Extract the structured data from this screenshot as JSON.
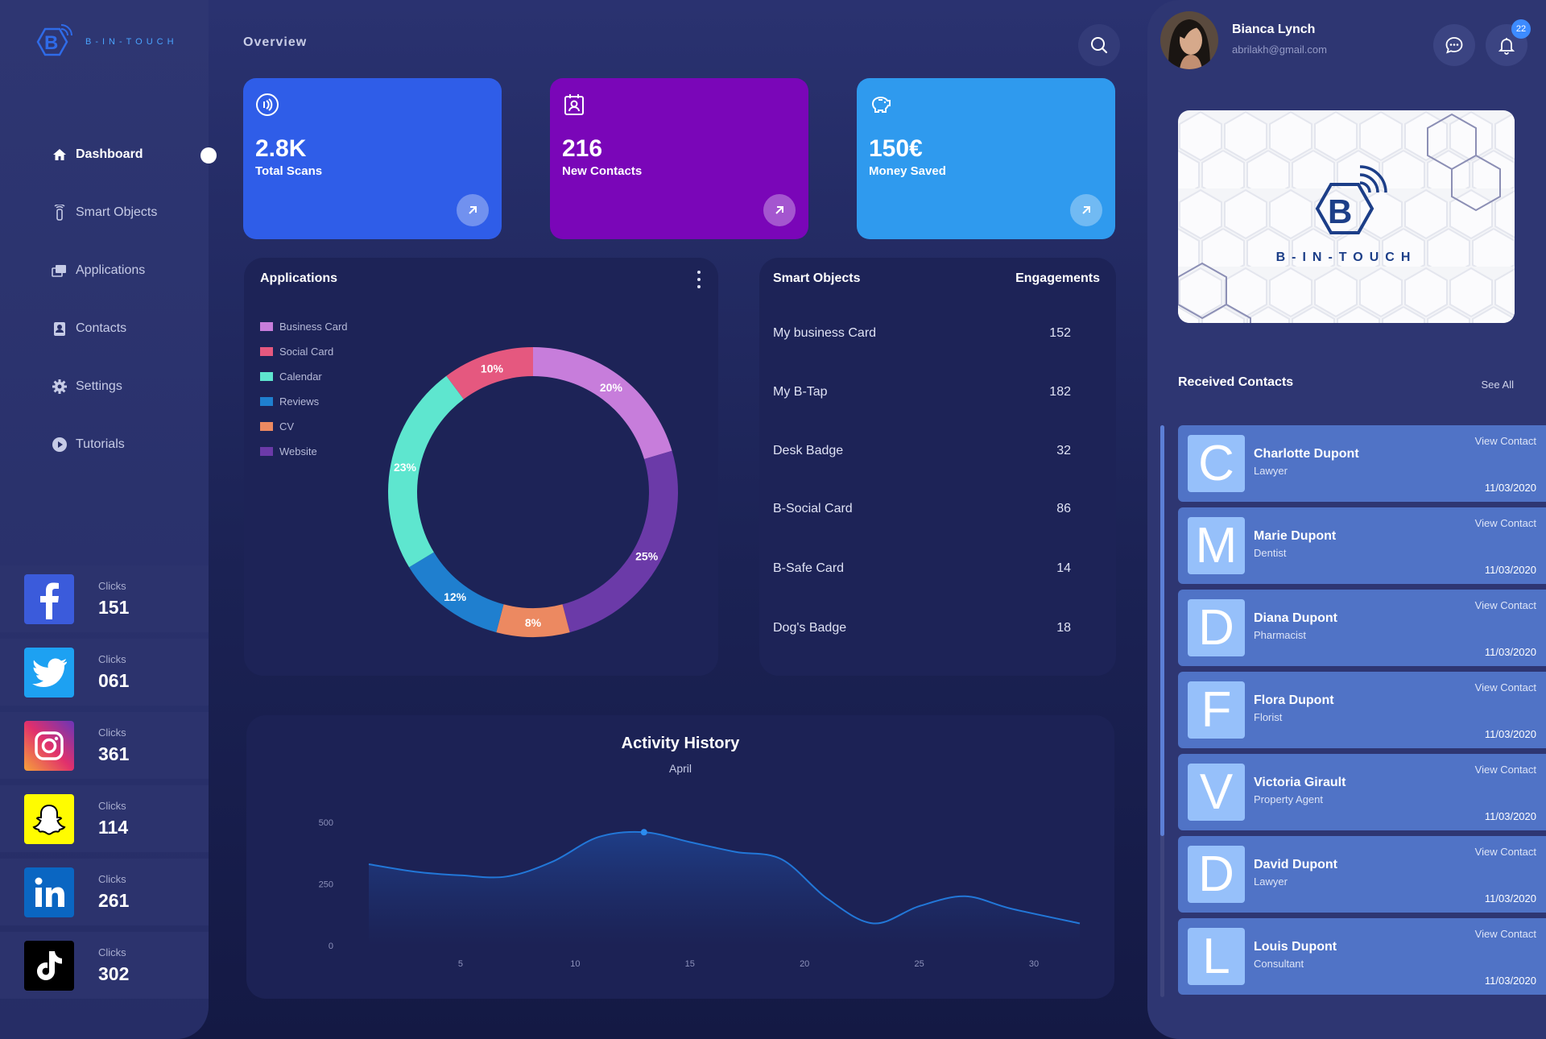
{
  "brand": {
    "name": "B-IN-TOUCH"
  },
  "nav": [
    {
      "label": "Dashboard",
      "icon": "home-icon",
      "active": true
    },
    {
      "label": "Smart Objects",
      "icon": "smart-object-icon"
    },
    {
      "label": "Applications",
      "icon": "applications-icon"
    },
    {
      "label": "Contacts",
      "icon": "contacts-icon"
    },
    {
      "label": "Settings",
      "icon": "gear-icon"
    },
    {
      "label": "Tutorials",
      "icon": "play-icon"
    }
  ],
  "socials": [
    {
      "network": "facebook",
      "label": "Clicks",
      "value": "151",
      "color": "#3b5bdb"
    },
    {
      "network": "twitter",
      "label": "Clicks",
      "value": "061",
      "color": "#1da1f2"
    },
    {
      "network": "instagram",
      "label": "Clicks",
      "value": "361",
      "color": "#c13584"
    },
    {
      "network": "snapchat",
      "label": "Clicks",
      "value": "114",
      "color": "#fffc00"
    },
    {
      "network": "linkedin",
      "label": "Clicks",
      "value": "261",
      "color": "#0a66c2"
    },
    {
      "network": "tiktok",
      "label": "Clicks",
      "value": "302",
      "color": "#000000"
    }
  ],
  "header": {
    "title": "Overview"
  },
  "stats": [
    {
      "value": "2.8K",
      "caption": "Total Scans",
      "color": "#2f5de8",
      "icon": "nfc-icon"
    },
    {
      "value": "216",
      "caption": "New Contacts",
      "color": "#7a06b8",
      "icon": "contact-card-icon"
    },
    {
      "value": "150€",
      "caption": "Money Saved",
      "color": "#2f9aee",
      "icon": "piggy-bank-icon"
    }
  ],
  "applications": {
    "title": "Applications",
    "legend": [
      {
        "label": "Business Card",
        "color": "#c77ddb"
      },
      {
        "label": "Social Card",
        "color": "#e5587f"
      },
      {
        "label": "Calendar",
        "color": "#5ee6cf"
      },
      {
        "label": "Reviews",
        "color": "#1f7fcf"
      },
      {
        "label": "CV",
        "color": "#ec8961"
      },
      {
        "label": "Website",
        "color": "#6b3aa8"
      }
    ]
  },
  "smart_objects": {
    "title": "Smart Objects",
    "col2": "Engagements",
    "rows": [
      {
        "name": "My business Card",
        "value": "152"
      },
      {
        "name": "My B-Tap",
        "value": "182"
      },
      {
        "name": "Desk Badge",
        "value": "32"
      },
      {
        "name": "B-Social Card",
        "value": "86"
      },
      {
        "name": "B-Safe Card",
        "value": "14"
      },
      {
        "name": "Dog's Badge",
        "value": "18"
      }
    ]
  },
  "activity": {
    "title": "Activity History",
    "subtitle": "April"
  },
  "chart_data": [
    {
      "type": "pie",
      "donut": true,
      "slices": [
        {
          "label": "20%",
          "value": 20,
          "color": "#c77ddb"
        },
        {
          "label": "25%",
          "value": 25,
          "color": "#6b3aa8"
        },
        {
          "label": "8%",
          "value": 8,
          "color": "#ec8961"
        },
        {
          "label": "12%",
          "value": 12,
          "color": "#1f7fcf"
        },
        {
          "label": "23%",
          "value": 23,
          "color": "#5ee6cf"
        },
        {
          "label": "10%",
          "value": 10,
          "color": "#e5587f"
        }
      ]
    },
    {
      "type": "area",
      "title": "Activity History",
      "subtitle": "April",
      "x": [
        1,
        3,
        5,
        7,
        9,
        11,
        13,
        15,
        17,
        19,
        21,
        23,
        25,
        27,
        29,
        32
      ],
      "y": [
        330,
        300,
        285,
        280,
        340,
        440,
        460,
        420,
        380,
        350,
        190,
        90,
        160,
        200,
        150,
        90
      ],
      "xticks": [
        5,
        10,
        15,
        20,
        25,
        30
      ],
      "yticks": [
        0,
        250,
        500
      ],
      "xlim": [
        1,
        32
      ],
      "ylim": [
        0,
        500
      ],
      "highlight_x": 13,
      "color": "#2277d8"
    }
  ],
  "user": {
    "name": "Bianca Lynch",
    "email": "abrilakh@gmail.com",
    "notifications": "22"
  },
  "received": {
    "title": "Received Contacts",
    "see_all": "See All",
    "contacts": [
      {
        "letter": "C",
        "name": "Charlotte Dupont",
        "role": "Lawyer",
        "action": "View Contact",
        "date": "11/03/2020"
      },
      {
        "letter": "M",
        "name": "Marie Dupont",
        "role": "Dentist",
        "action": "View Contact",
        "date": "11/03/2020"
      },
      {
        "letter": "D",
        "name": "Diana Dupont",
        "role": "Pharmacist",
        "action": "View Contact",
        "date": "11/03/2020"
      },
      {
        "letter": "F",
        "name": "Flora Dupont",
        "role": "Florist",
        "action": "View Contact",
        "date": "11/03/2020"
      },
      {
        "letter": "V",
        "name": "Victoria Girault",
        "role": "Property Agent",
        "action": "View Contact",
        "date": "11/03/2020"
      },
      {
        "letter": "D",
        "name": "David Dupont",
        "role": "Lawyer",
        "action": "View Contact",
        "date": "11/03/2020"
      },
      {
        "letter": "L",
        "name": "Louis Dupont",
        "role": "Consultant",
        "action": "View Contact",
        "date": "11/03/2020"
      }
    ]
  }
}
